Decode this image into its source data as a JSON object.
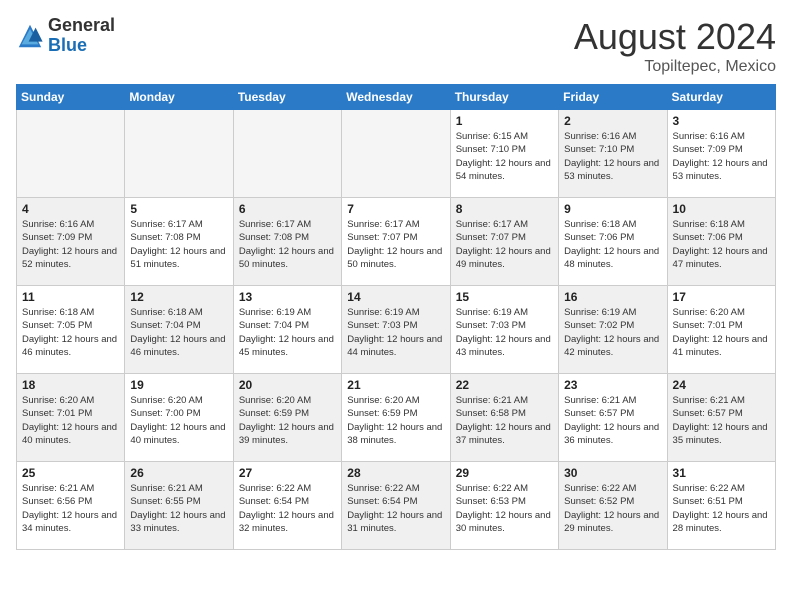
{
  "header": {
    "logo": {
      "general": "General",
      "blue": "Blue"
    },
    "title": "August 2024",
    "location": "Topiltepec, Mexico"
  },
  "days_of_week": [
    "Sunday",
    "Monday",
    "Tuesday",
    "Wednesday",
    "Thursday",
    "Friday",
    "Saturday"
  ],
  "weeks": [
    [
      {
        "day": "",
        "empty": true
      },
      {
        "day": "",
        "empty": true
      },
      {
        "day": "",
        "empty": true
      },
      {
        "day": "",
        "empty": true
      },
      {
        "day": "1",
        "sunrise": "Sunrise: 6:15 AM",
        "sunset": "Sunset: 7:10 PM",
        "daylight": "Daylight: 12 hours and 54 minutes.",
        "shaded": false
      },
      {
        "day": "2",
        "sunrise": "Sunrise: 6:16 AM",
        "sunset": "Sunset: 7:10 PM",
        "daylight": "Daylight: 12 hours and 53 minutes.",
        "shaded": true
      },
      {
        "day": "3",
        "sunrise": "Sunrise: 6:16 AM",
        "sunset": "Sunset: 7:09 PM",
        "daylight": "Daylight: 12 hours and 53 minutes.",
        "shaded": false
      }
    ],
    [
      {
        "day": "4",
        "sunrise": "Sunrise: 6:16 AM",
        "sunset": "Sunset: 7:09 PM",
        "daylight": "Daylight: 12 hours and 52 minutes.",
        "shaded": true
      },
      {
        "day": "5",
        "sunrise": "Sunrise: 6:17 AM",
        "sunset": "Sunset: 7:08 PM",
        "daylight": "Daylight: 12 hours and 51 minutes.",
        "shaded": false
      },
      {
        "day": "6",
        "sunrise": "Sunrise: 6:17 AM",
        "sunset": "Sunset: 7:08 PM",
        "daylight": "Daylight: 12 hours and 50 minutes.",
        "shaded": true
      },
      {
        "day": "7",
        "sunrise": "Sunrise: 6:17 AM",
        "sunset": "Sunset: 7:07 PM",
        "daylight": "Daylight: 12 hours and 50 minutes.",
        "shaded": false
      },
      {
        "day": "8",
        "sunrise": "Sunrise: 6:17 AM",
        "sunset": "Sunset: 7:07 PM",
        "daylight": "Daylight: 12 hours and 49 minutes.",
        "shaded": true
      },
      {
        "day": "9",
        "sunrise": "Sunrise: 6:18 AM",
        "sunset": "Sunset: 7:06 PM",
        "daylight": "Daylight: 12 hours and 48 minutes.",
        "shaded": false
      },
      {
        "day": "10",
        "sunrise": "Sunrise: 6:18 AM",
        "sunset": "Sunset: 7:06 PM",
        "daylight": "Daylight: 12 hours and 47 minutes.",
        "shaded": true
      }
    ],
    [
      {
        "day": "11",
        "sunrise": "Sunrise: 6:18 AM",
        "sunset": "Sunset: 7:05 PM",
        "daylight": "Daylight: 12 hours and 46 minutes.",
        "shaded": false
      },
      {
        "day": "12",
        "sunrise": "Sunrise: 6:18 AM",
        "sunset": "Sunset: 7:04 PM",
        "daylight": "Daylight: 12 hours and 46 minutes.",
        "shaded": true
      },
      {
        "day": "13",
        "sunrise": "Sunrise: 6:19 AM",
        "sunset": "Sunset: 7:04 PM",
        "daylight": "Daylight: 12 hours and 45 minutes.",
        "shaded": false
      },
      {
        "day": "14",
        "sunrise": "Sunrise: 6:19 AM",
        "sunset": "Sunset: 7:03 PM",
        "daylight": "Daylight: 12 hours and 44 minutes.",
        "shaded": true
      },
      {
        "day": "15",
        "sunrise": "Sunrise: 6:19 AM",
        "sunset": "Sunset: 7:03 PM",
        "daylight": "Daylight: 12 hours and 43 minutes.",
        "shaded": false
      },
      {
        "day": "16",
        "sunrise": "Sunrise: 6:19 AM",
        "sunset": "Sunset: 7:02 PM",
        "daylight": "Daylight: 12 hours and 42 minutes.",
        "shaded": true
      },
      {
        "day": "17",
        "sunrise": "Sunrise: 6:20 AM",
        "sunset": "Sunset: 7:01 PM",
        "daylight": "Daylight: 12 hours and 41 minutes.",
        "shaded": false
      }
    ],
    [
      {
        "day": "18",
        "sunrise": "Sunrise: 6:20 AM",
        "sunset": "Sunset: 7:01 PM",
        "daylight": "Daylight: 12 hours and 40 minutes.",
        "shaded": true
      },
      {
        "day": "19",
        "sunrise": "Sunrise: 6:20 AM",
        "sunset": "Sunset: 7:00 PM",
        "daylight": "Daylight: 12 hours and 40 minutes.",
        "shaded": false
      },
      {
        "day": "20",
        "sunrise": "Sunrise: 6:20 AM",
        "sunset": "Sunset: 6:59 PM",
        "daylight": "Daylight: 12 hours and 39 minutes.",
        "shaded": true
      },
      {
        "day": "21",
        "sunrise": "Sunrise: 6:20 AM",
        "sunset": "Sunset: 6:59 PM",
        "daylight": "Daylight: 12 hours and 38 minutes.",
        "shaded": false
      },
      {
        "day": "22",
        "sunrise": "Sunrise: 6:21 AM",
        "sunset": "Sunset: 6:58 PM",
        "daylight": "Daylight: 12 hours and 37 minutes.",
        "shaded": true
      },
      {
        "day": "23",
        "sunrise": "Sunrise: 6:21 AM",
        "sunset": "Sunset: 6:57 PM",
        "daylight": "Daylight: 12 hours and 36 minutes.",
        "shaded": false
      },
      {
        "day": "24",
        "sunrise": "Sunrise: 6:21 AM",
        "sunset": "Sunset: 6:57 PM",
        "daylight": "Daylight: 12 hours and 35 minutes.",
        "shaded": true
      }
    ],
    [
      {
        "day": "25",
        "sunrise": "Sunrise: 6:21 AM",
        "sunset": "Sunset: 6:56 PM",
        "daylight": "Daylight: 12 hours and 34 minutes.",
        "shaded": false
      },
      {
        "day": "26",
        "sunrise": "Sunrise: 6:21 AM",
        "sunset": "Sunset: 6:55 PM",
        "daylight": "Daylight: 12 hours and 33 minutes.",
        "shaded": true
      },
      {
        "day": "27",
        "sunrise": "Sunrise: 6:22 AM",
        "sunset": "Sunset: 6:54 PM",
        "daylight": "Daylight: 12 hours and 32 minutes.",
        "shaded": false
      },
      {
        "day": "28",
        "sunrise": "Sunrise: 6:22 AM",
        "sunset": "Sunset: 6:54 PM",
        "daylight": "Daylight: 12 hours and 31 minutes.",
        "shaded": true
      },
      {
        "day": "29",
        "sunrise": "Sunrise: 6:22 AM",
        "sunset": "Sunset: 6:53 PM",
        "daylight": "Daylight: 12 hours and 30 minutes.",
        "shaded": false
      },
      {
        "day": "30",
        "sunrise": "Sunrise: 6:22 AM",
        "sunset": "Sunset: 6:52 PM",
        "daylight": "Daylight: 12 hours and 29 minutes.",
        "shaded": true
      },
      {
        "day": "31",
        "sunrise": "Sunrise: 6:22 AM",
        "sunset": "Sunset: 6:51 PM",
        "daylight": "Daylight: 12 hours and 28 minutes.",
        "shaded": false
      }
    ]
  ]
}
